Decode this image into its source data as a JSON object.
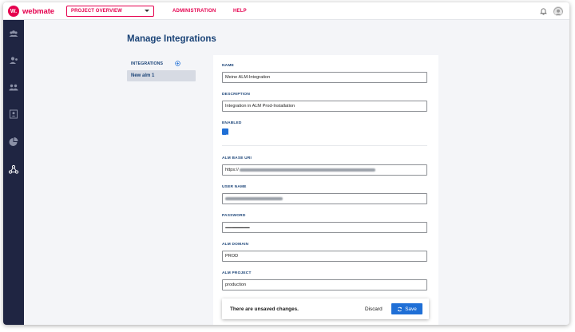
{
  "header": {
    "brand": "webmate",
    "brand_initials": "W.",
    "project_dropdown": "PROJECT OVERVIEW",
    "nav": [
      "ADMINISTRATION",
      "HELP"
    ]
  },
  "page": {
    "title": "Manage Integrations"
  },
  "integrations": {
    "header": "INTEGRATIONS",
    "items": [
      "New alm 1"
    ]
  },
  "form": {
    "name_label": "NAME",
    "name_value": "Meine ALM-Integration",
    "description_label": "DESCRIPTION",
    "description_value": "Integration in ALM Prod-Installation",
    "enabled_label": "ENABLED",
    "enabled": true,
    "alm_base_uri_label": "ALM BASE URI",
    "alm_base_uri_value": "https://",
    "user_name_label": "USER NAME",
    "password_label": "PASSWORD",
    "password_value": "••••••••••••••••••••••••••••••",
    "alm_domain_label": "ALM DOMAIN",
    "alm_domain_value": "PROD",
    "alm_project_label": "ALM PROJECT",
    "alm_project_value": "production"
  },
  "toast": {
    "message": "There are unsaved changes.",
    "discard_label": "Discard",
    "save_label": "Save"
  },
  "colors": {
    "brand": "#e5004e",
    "sidebar": "#1f2542",
    "accent": "#1f6fd6",
    "heading": "#1a4377"
  }
}
